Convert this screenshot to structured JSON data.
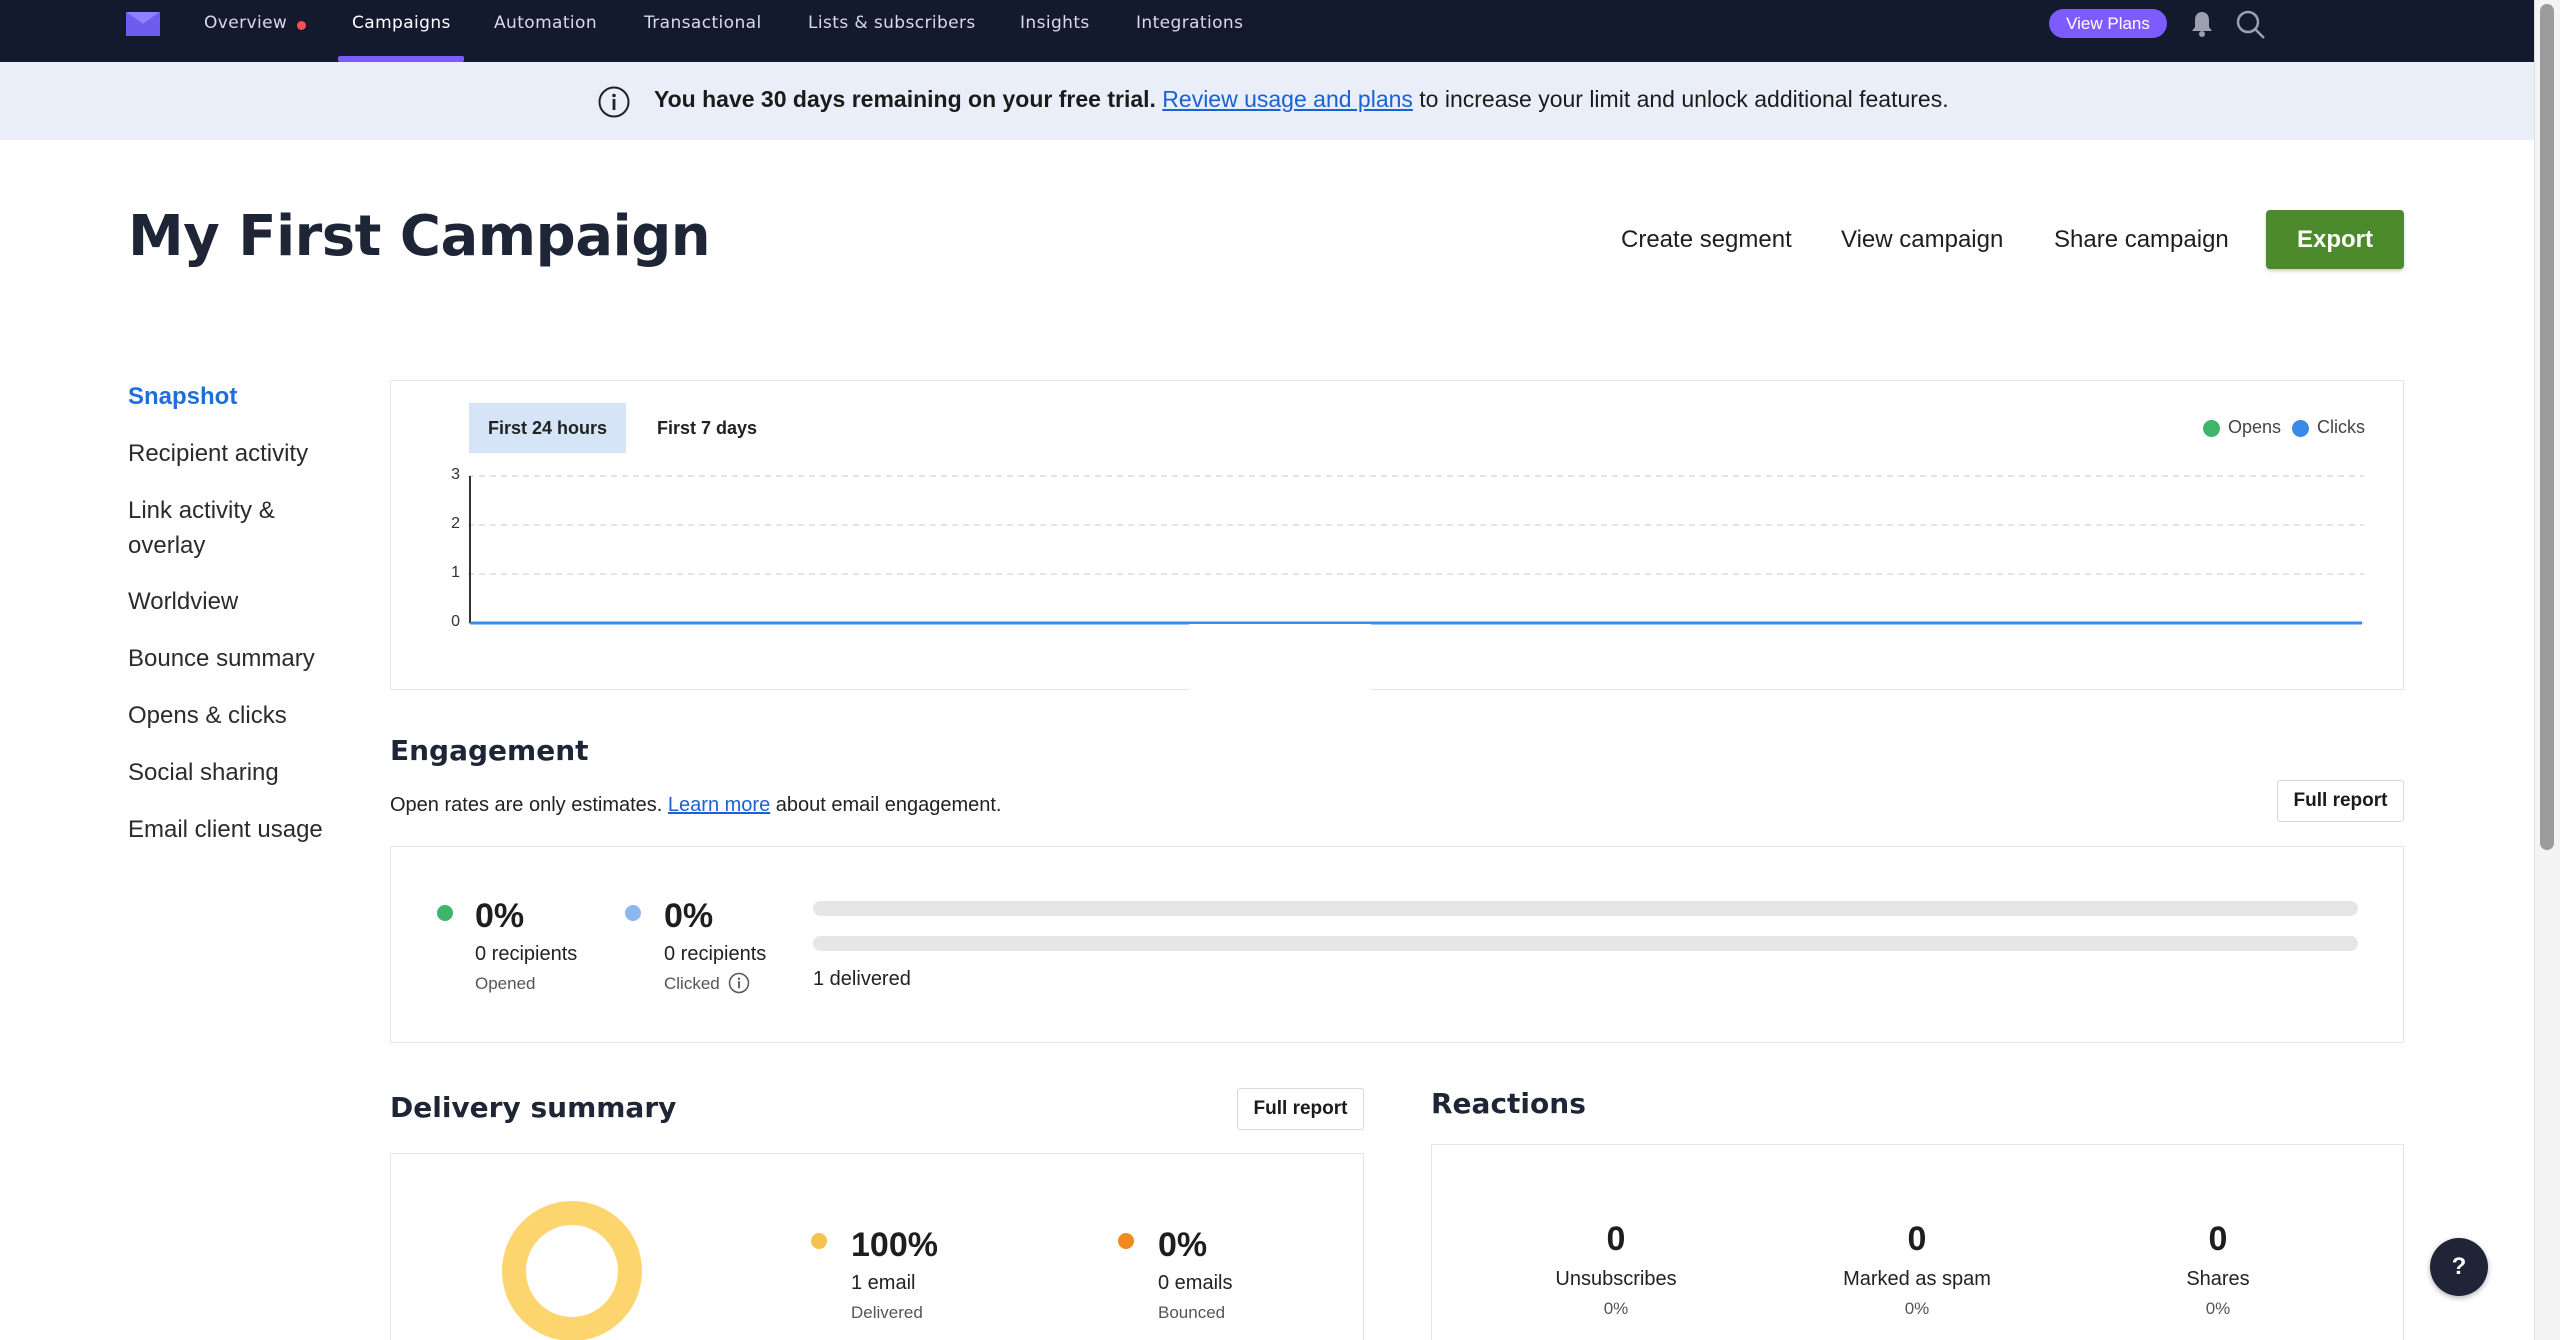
{
  "nav": {
    "items": [
      "Overview",
      "Campaigns",
      "Automation",
      "Transactional",
      "Lists & subscribers",
      "Insights",
      "Integrations"
    ],
    "active": "Campaigns",
    "view_plans": "View Plans"
  },
  "banner": {
    "bold_text": "You have 30 days remaining on your free trial.",
    "link_text": "Review usage and plans",
    "tail_text": " to increase your limit and unlock additional features."
  },
  "header": {
    "title": "My First Campaign",
    "create_segment": "Create segment",
    "view_campaign": "View campaign",
    "share_campaign": "Share campaign",
    "export": "Export"
  },
  "sidebar": {
    "items": [
      "Snapshot",
      "Recipient activity",
      "Link activity &",
      "overlay",
      "Worldview",
      "Bounce summary",
      "Opens & clicks",
      "Social sharing",
      "Email client usage"
    ]
  },
  "chart": {
    "tabs": [
      "First 24 hours",
      "First 7 days"
    ],
    "selected_tab": "First 24 hours",
    "legend": [
      "Opens",
      "Clicks"
    ]
  },
  "chart_data": {
    "type": "line",
    "series": [
      {
        "name": "Opens",
        "color": "#3db56b",
        "values": [
          0,
          0
        ]
      },
      {
        "name": "Clicks",
        "color": "#3b8be6",
        "values": [
          0,
          0
        ]
      }
    ],
    "yticks": [
      "3",
      "2",
      "1",
      "0"
    ],
    "ylim": [
      0,
      3
    ],
    "grid": true,
    "legend_position": "top-right"
  },
  "engagement": {
    "title": "Engagement",
    "note_prefix": "Open rates are only estimates. ",
    "note_link": "Learn more",
    "note_suffix": " about email engagement.",
    "full_report": "Full report",
    "opened": {
      "pct": "0%",
      "count": "0 recipients",
      "label": "Opened",
      "color": "#3db56b"
    },
    "clicked": {
      "pct": "0%",
      "count": "0 recipients",
      "label": "Clicked",
      "color": "#8db7f0"
    },
    "delivered": "1 delivered"
  },
  "delivery": {
    "title": "Delivery summary",
    "full_report": "Full report",
    "delivered": {
      "pct": "100%",
      "count": "1 email",
      "label": "Delivered",
      "color": "#f6c24e"
    },
    "bounced": {
      "pct": "0%",
      "count": "0 emails",
      "label": "Bounced",
      "color": "#f08a1c"
    }
  },
  "reactions": {
    "title": "Reactions",
    "items": [
      {
        "value": "0",
        "label": "Unsubscribes",
        "pct": "0%"
      },
      {
        "value": "0",
        "label": "Marked as spam",
        "pct": "0%"
      },
      {
        "value": "0",
        "label": "Shares",
        "pct": "0%"
      }
    ]
  },
  "help": "?"
}
